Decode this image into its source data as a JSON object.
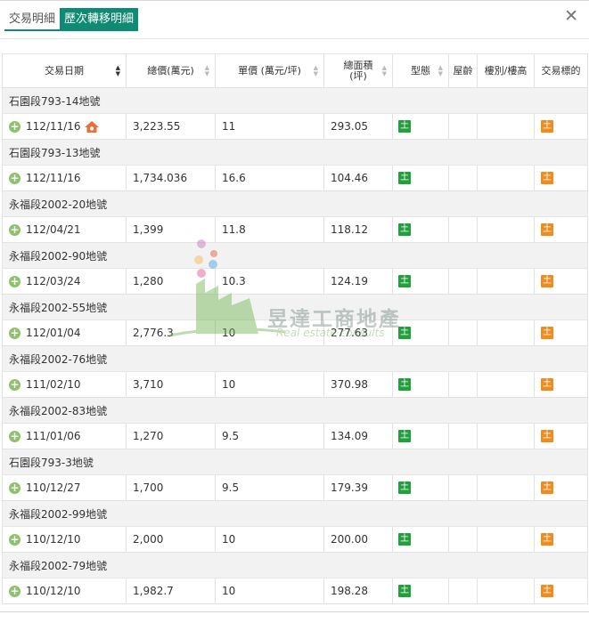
{
  "tabs": [
    {
      "label": "交易明細",
      "active": false
    },
    {
      "label": "歷次轉移明細",
      "active": true
    }
  ],
  "close_icon": "close-icon",
  "table": {
    "columns": [
      "交易日期",
      "總價(萬元)",
      "單價 (萬元/坪)",
      "總面積\n(坪)",
      "型態",
      "屋齡",
      "樓別/樓高",
      "交易標的"
    ],
    "groups": [
      {
        "title": "石園段793-14地號",
        "date": "112/11/16",
        "total": "3,223.55",
        "unit": "11",
        "area": "293.05",
        "type": "土",
        "age": "",
        "floor": "",
        "target": "土",
        "house_icon": true
      },
      {
        "title": "石園段793-13地號",
        "date": "112/11/16",
        "total": "1,734.036",
        "unit": "16.6",
        "area": "104.46",
        "type": "土",
        "age": "",
        "floor": "",
        "target": "土",
        "house_icon": false
      },
      {
        "title": "永福段2002-20地號",
        "date": "112/04/21",
        "total": "1,399",
        "unit": "11.8",
        "area": "118.12",
        "type": "土",
        "age": "",
        "floor": "",
        "target": "土",
        "house_icon": false
      },
      {
        "title": "永福段2002-90地號",
        "date": "112/03/24",
        "total": "1,280",
        "unit": "10.3",
        "area": "124.19",
        "type": "土",
        "age": "",
        "floor": "",
        "target": "土",
        "house_icon": false
      },
      {
        "title": "永福段2002-55地號",
        "date": "112/01/04",
        "total": "2,776.3",
        "unit": "10",
        "area": "277.63",
        "type": "土",
        "age": "",
        "floor": "",
        "target": "土",
        "house_icon": false
      },
      {
        "title": "永福段2002-76地號",
        "date": "111/02/10",
        "total": "3,710",
        "unit": "10",
        "area": "370.98",
        "type": "土",
        "age": "",
        "floor": "",
        "target": "土",
        "house_icon": false
      },
      {
        "title": "永福段2002-83地號",
        "date": "111/01/06",
        "total": "1,270",
        "unit": "9.5",
        "area": "134.09",
        "type": "土",
        "age": "",
        "floor": "",
        "target": "土",
        "house_icon": false
      },
      {
        "title": "石園段793-3地號",
        "date": "110/12/27",
        "total": "1,700",
        "unit": "9.5",
        "area": "179.39",
        "type": "土",
        "age": "",
        "floor": "",
        "target": "土",
        "house_icon": false
      },
      {
        "title": "永福段2002-99地號",
        "date": "110/12/10",
        "total": "2,000",
        "unit": "10",
        "area": "200.00",
        "type": "土",
        "age": "",
        "floor": "",
        "target": "土",
        "house_icon": false
      },
      {
        "title": "永福段2002-79地號",
        "date": "110/12/10",
        "total": "1,982.7",
        "unit": "10",
        "area": "198.28",
        "type": "土",
        "age": "",
        "floor": "",
        "target": "土",
        "house_icon": false
      }
    ]
  },
  "watermark": {
    "name": "昱達工商地產",
    "sub": "Real estate consults"
  },
  "colors": {
    "accent": "#0f8a73",
    "type_green": "#22a03c",
    "target_orange": "#f08c1e",
    "plus_green": "#8dc26b"
  }
}
